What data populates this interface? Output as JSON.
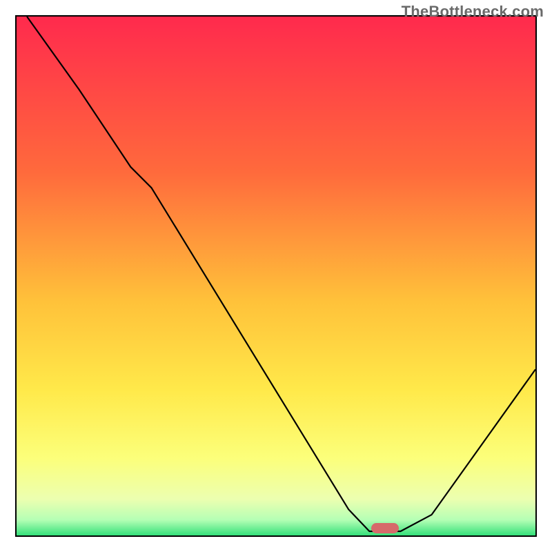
{
  "watermark": "TheBottleneck.com",
  "chart_data": {
    "type": "line",
    "title": "",
    "xlabel": "",
    "ylabel": "",
    "xlim": [
      0,
      100
    ],
    "ylim": [
      0,
      100
    ],
    "grid": false,
    "background_gradient": {
      "stops": [
        {
          "offset": 0.0,
          "color": "#ff2a4d"
        },
        {
          "offset": 0.3,
          "color": "#ff6a3c"
        },
        {
          "offset": 0.55,
          "color": "#ffc23a"
        },
        {
          "offset": 0.72,
          "color": "#ffe94a"
        },
        {
          "offset": 0.85,
          "color": "#fcff7a"
        },
        {
          "offset": 0.93,
          "color": "#ecffb0"
        },
        {
          "offset": 0.97,
          "color": "#b5ffb5"
        },
        {
          "offset": 1.0,
          "color": "#35e07a"
        }
      ]
    },
    "series": [
      {
        "name": "bottleneck-curve",
        "x": [
          2,
          12,
          22,
          26,
          64,
          68,
          74,
          80,
          100
        ],
        "y": [
          100,
          86,
          71,
          67,
          5,
          0.8,
          0.8,
          4,
          32
        ],
        "style": {
          "stroke": "#000000",
          "stroke_width": 2.2,
          "fill": "none"
        }
      }
    ],
    "markers": [
      {
        "name": "optimal-zone-marker",
        "x": 71,
        "y": 1.4,
        "shape": "rounded-bar",
        "color": "#d66a6a",
        "width_pct": 5.3,
        "height_pct": 1.9
      }
    ]
  }
}
